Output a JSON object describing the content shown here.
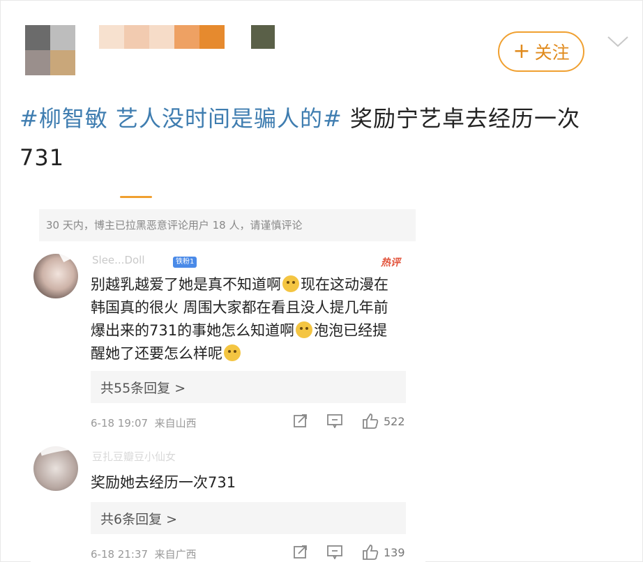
{
  "post": {
    "follow_label": "关注",
    "topic1": "#柳智敏 艺人没时间是骗人的#",
    "text_rest": " 奖励宁艺卓去经历一次",
    "text_line2": "731"
  },
  "comments_panel": {
    "notice": "30 天内，博主已拉黑恶意评论用户 18 人，请谨慎评论",
    "hot_label": "热评",
    "comments": [
      {
        "name": "Slee...Doll",
        "badge": "铁粉1",
        "text_a": "别越乳越爱了她是真不知道啊",
        "text_b": "现在这动漫在韩国真的很火 周围大家都在看且没人提几年前爆出来的731的事她怎么知道啊",
        "text_c": "泡泡已经提醒她了还要怎么样呢",
        "replies": "共55条回复 >",
        "time": "6-18 19:07",
        "location": "来自山西",
        "likes": "522"
      },
      {
        "name": "豆扎豆瓣豆小仙女",
        "text": "奖励她去经历一次731",
        "replies": "共6条回复 >",
        "time": "6-18 21:37",
        "location": "来自广西",
        "likes": "139"
      }
    ]
  },
  "colors": {
    "topic": "#3f7db0",
    "accent": "#f0a030",
    "hot": "#e2543c"
  }
}
